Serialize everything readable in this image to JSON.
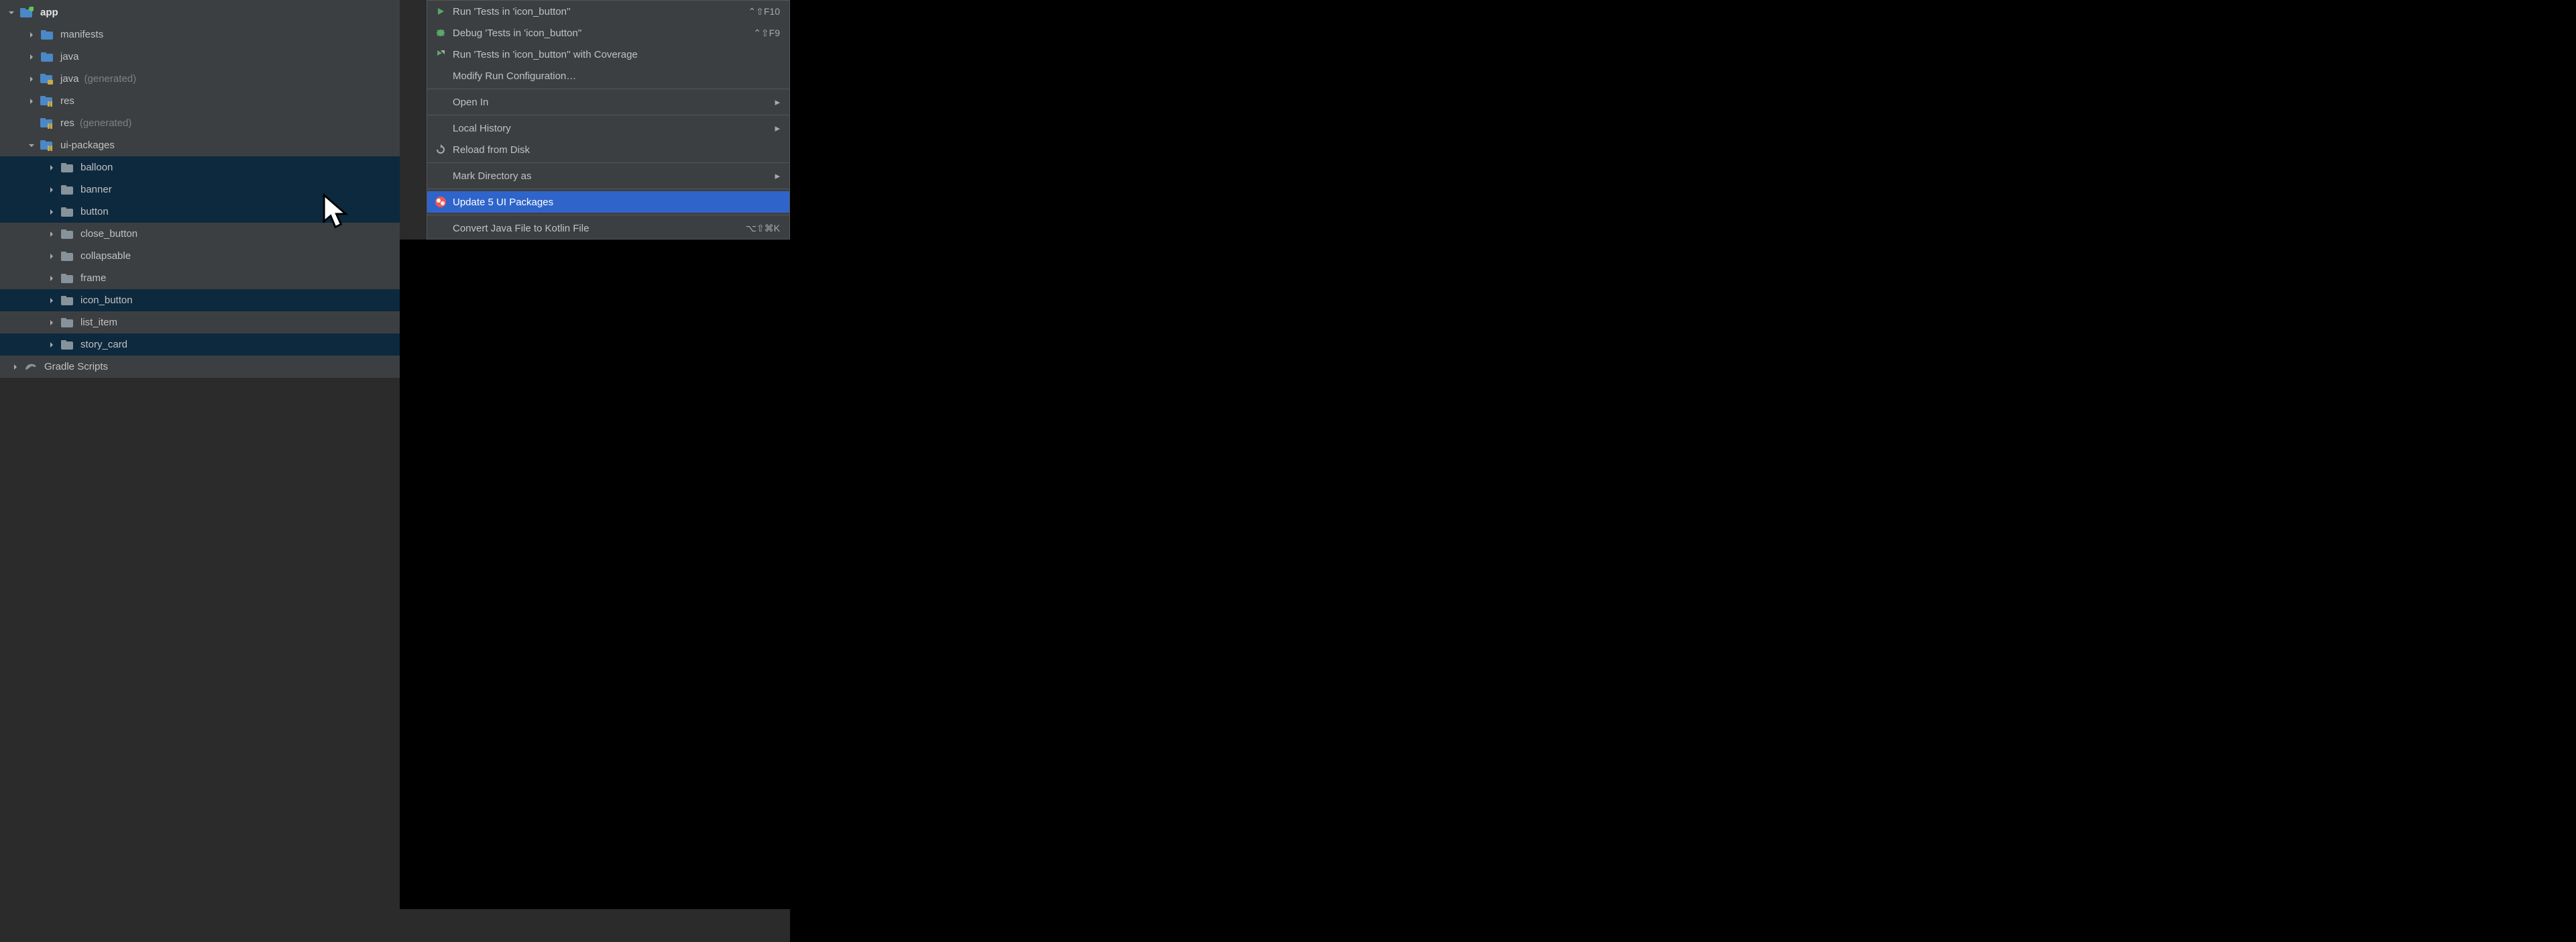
{
  "tree": {
    "app": {
      "label": "app"
    },
    "manifests": {
      "label": "manifests"
    },
    "java": {
      "label": "java"
    },
    "java_gen": {
      "label": "java",
      "suffix": "(generated)"
    },
    "res": {
      "label": "res"
    },
    "res_gen": {
      "label": "res",
      "suffix": "(generated)"
    },
    "ui_packages": {
      "label": "ui-packages"
    },
    "balloon": {
      "label": "balloon"
    },
    "banner": {
      "label": "banner"
    },
    "button": {
      "label": "button"
    },
    "close_button": {
      "label": "close_button"
    },
    "collapsable": {
      "label": "collapsable"
    },
    "frame": {
      "label": "frame"
    },
    "icon_button": {
      "label": "icon_button"
    },
    "list_item": {
      "label": "list_item"
    },
    "story_card": {
      "label": "story_card"
    },
    "gradle": {
      "label": "Gradle Scripts"
    }
  },
  "menu": {
    "run": {
      "label": "Run 'Tests in 'icon_button''",
      "shortcut": "⌃⇧F10"
    },
    "debug": {
      "label": "Debug 'Tests in 'icon_button''",
      "shortcut": "⌃⇧F9"
    },
    "coverage": {
      "label": "Run 'Tests in 'icon_button'' with Coverage"
    },
    "modify": {
      "label": "Modify Run Configuration…"
    },
    "open_in": {
      "label": "Open In"
    },
    "local_history": {
      "label": "Local History"
    },
    "reload": {
      "label": "Reload from Disk"
    },
    "mark_dir": {
      "label": "Mark Directory as"
    },
    "update": {
      "label": "Update 5 UI Packages"
    },
    "convert": {
      "label": "Convert Java File to Kotlin File",
      "shortcut": "⌥⇧⌘K"
    }
  }
}
